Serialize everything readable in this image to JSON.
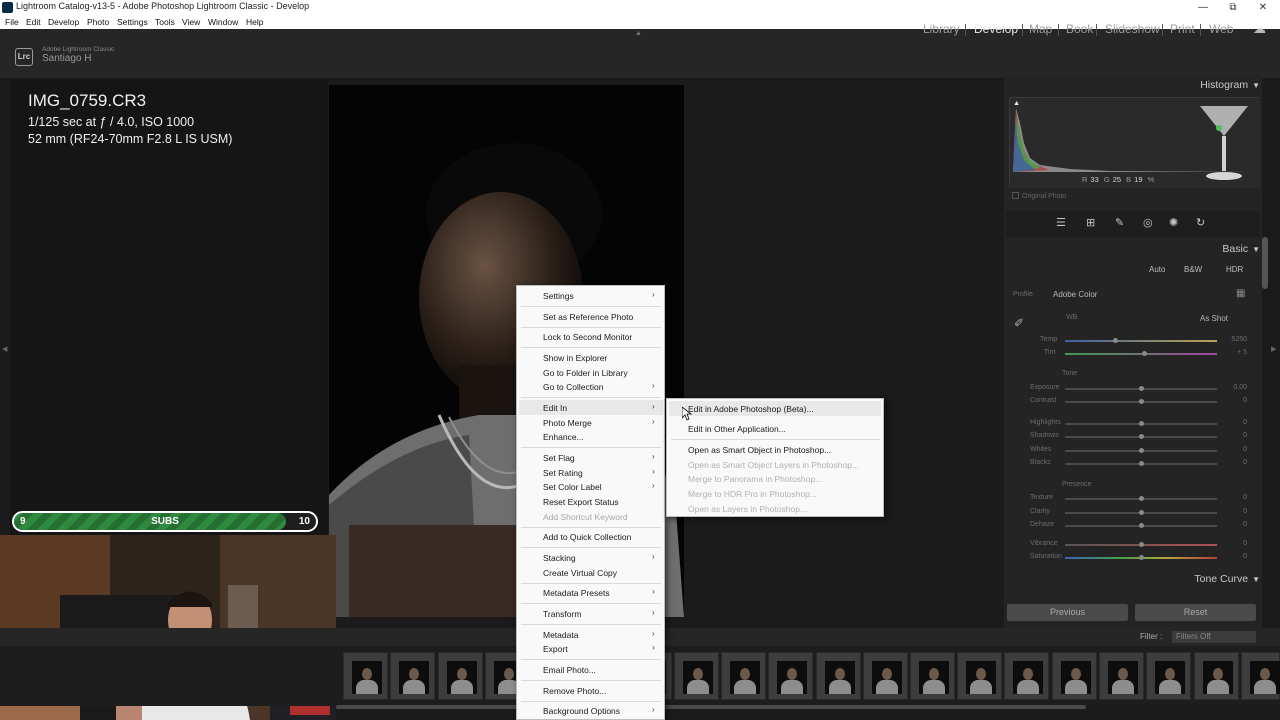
{
  "window": {
    "title": "Lightroom Catalog-v13-5 - Adobe Photoshop Lightroom Classic - Develop",
    "minimize": "—",
    "restore": "⧉",
    "close": "✕"
  },
  "menubar": [
    "File",
    "Edit",
    "Develop",
    "Photo",
    "Settings",
    "Tools",
    "View",
    "Window",
    "Help"
  ],
  "identity": {
    "badge": "Lrc",
    "product": "Adobe Lightroom Classic",
    "user": "Santiago H"
  },
  "modules": {
    "items": [
      "Library",
      "Develop",
      "Map",
      "Book",
      "Slideshow",
      "Print",
      "Web"
    ],
    "active": "Develop"
  },
  "photo_info": {
    "filename": "IMG_0759.CR3",
    "exposure": "1/125 sec at ƒ / 4.0, ISO 1000",
    "lens": "52 mm (RF24-70mm F2.8 L IS USM)"
  },
  "subs_goal": {
    "current": "9",
    "label": "SUBS",
    "target": "10",
    "progress_fraction": 0.9
  },
  "right_panel": {
    "histogram_title": "Histogram",
    "rgb": {
      "r_label": "R",
      "r": "33",
      "g_label": "G",
      "g": "25",
      "b_label": "B",
      "b": "19",
      "unit": "%"
    },
    "original_photo": "Original Photo",
    "basic_title": "Basic",
    "treatment_buttons": [
      "Auto",
      "B&W",
      "HDR"
    ],
    "profile_label": "Profile",
    "profile_value": "Adobe Color",
    "wb_label": "WB",
    "wb_value": "As Shot",
    "temp": {
      "label": "Temp",
      "value": "5250",
      "position": 0.33
    },
    "tint": {
      "label": "Tint",
      "value": "+ 5",
      "position": 0.52
    },
    "tone_header": "Tone",
    "tone": [
      {
        "label": "Exposure",
        "value": "0.00",
        "position": 0.5
      },
      {
        "label": "Contrast",
        "value": "0",
        "position": 0.5
      },
      {
        "label": "Highlights",
        "value": "0",
        "position": 0.5
      },
      {
        "label": "Shadows",
        "value": "0",
        "position": 0.5
      },
      {
        "label": "Whites",
        "value": "0",
        "position": 0.5
      },
      {
        "label": "Blacks",
        "value": "0",
        "position": 0.5
      }
    ],
    "presence_header": "Presence",
    "presence": [
      {
        "label": "Texture",
        "value": "0",
        "position": 0.5
      },
      {
        "label": "Clarity",
        "value": "0",
        "position": 0.5
      },
      {
        "label": "Dehaze",
        "value": "0",
        "position": 0.5
      },
      {
        "label": "Vibrance",
        "value": "0",
        "position": 0.5
      },
      {
        "label": "Saturation",
        "value": "0",
        "position": 0.5
      }
    ],
    "tone_curve_title": "Tone Curve",
    "previous_button": "Previous",
    "reset_button": "Reset"
  },
  "filmstrip": {
    "filter_label": "Filter :",
    "filter_value": "Filters Off"
  },
  "context_menu": {
    "items": [
      {
        "label": "Settings",
        "submenu": true
      },
      {
        "label": "Set as Reference Photo"
      },
      {
        "label": "Lock to Second Monitor"
      },
      {
        "label": "Show in Explorer"
      },
      {
        "label": "Go to Folder in Library"
      },
      {
        "label": "Go to Collection",
        "submenu": true
      },
      {
        "label": "Edit In",
        "submenu": true,
        "highlighted": true
      },
      {
        "label": "Photo Merge",
        "submenu": true
      },
      {
        "label": "Enhance..."
      },
      {
        "label": "Set Flag",
        "submenu": true
      },
      {
        "label": "Set Rating",
        "submenu": true
      },
      {
        "label": "Set Color Label",
        "submenu": true
      },
      {
        "label": "Reset Export Status"
      },
      {
        "label": "Add Shortcut Keyword",
        "disabled": true
      },
      {
        "label": "Add to Quick Collection"
      },
      {
        "label": "Stacking",
        "submenu": true
      },
      {
        "label": "Create Virtual Copy"
      },
      {
        "label": "Metadata Presets",
        "submenu": true
      },
      {
        "label": "Transform",
        "submenu": true
      },
      {
        "label": "Metadata",
        "submenu": true
      },
      {
        "label": "Export",
        "submenu": true
      },
      {
        "label": "Email Photo..."
      },
      {
        "label": "Remove Photo..."
      },
      {
        "label": "Background Options",
        "submenu": true
      }
    ]
  },
  "edit_in_submenu": {
    "items": [
      {
        "label": "Edit in Adobe Photoshop (Beta)...",
        "highlighted": true
      },
      {
        "label": "Edit in Other Application..."
      },
      {
        "label": "Open as Smart Object in Photoshop..."
      },
      {
        "label": "Open as Smart Object Layers in Photoshop...",
        "disabled": true
      },
      {
        "label": "Merge to Panorama in Photoshop...",
        "disabled": true
      },
      {
        "label": "Merge to HDR Pro in Photoshop...",
        "disabled": true
      },
      {
        "label": "Open as Layers in Photoshop...",
        "disabled": true
      }
    ]
  },
  "icons": {
    "submenu_arrow": "›",
    "panel_collapse": "▼",
    "cloud": "☁"
  }
}
